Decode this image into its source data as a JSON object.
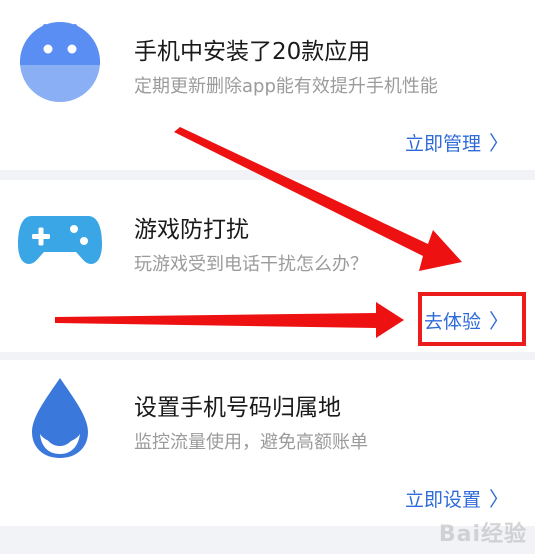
{
  "items": [
    {
      "title": "手机中安装了20款应用",
      "description": "定期更新删除app能有效提升手机性能",
      "action": "立即管理",
      "icon": "android-robot-icon",
      "color": "#5b8ef2"
    },
    {
      "title": "游戏防打扰",
      "description": "玩游戏受到电话干扰怎么办？",
      "action": "去体验",
      "icon": "gamepad-icon",
      "color": "#3aa6e6"
    },
    {
      "title": "设置手机号码归属地",
      "description": "监控流量使用，避免高额账单",
      "action": "立即设置",
      "icon": "water-drop-icon",
      "color": "#3a78dc"
    }
  ],
  "chevron": "〉",
  "annotation": {
    "highlight_color": "#ec1c1c",
    "arrow_color": "#ee1111"
  },
  "watermark": "Bai经验"
}
